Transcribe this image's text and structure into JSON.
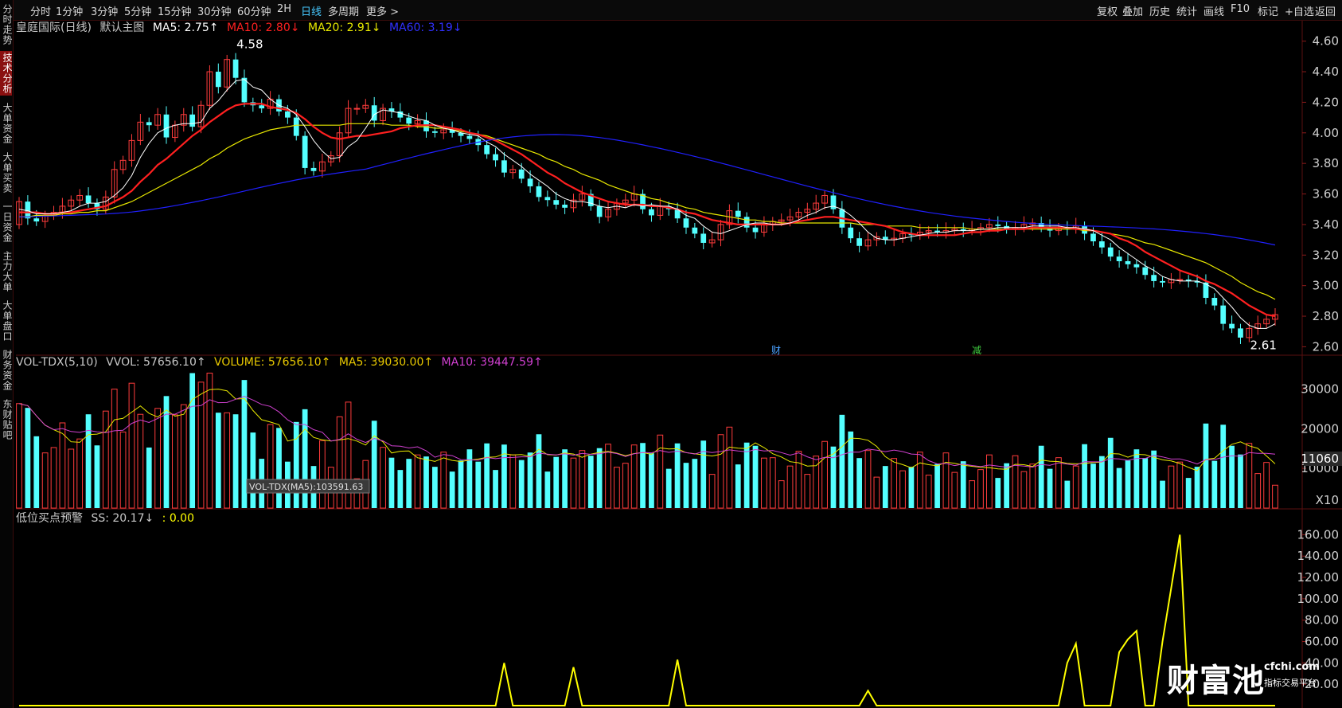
{
  "toolbar": {
    "periods": [
      "分时",
      "1分钟",
      "3分钟",
      "5分钟",
      "15分钟",
      "30分钟",
      "60分钟",
      "2H",
      "日线",
      "多周期",
      "更多 >"
    ],
    "active_period": "日线",
    "tools": [
      "复权",
      "叠加",
      "历史",
      "统计",
      "画线",
      "F10",
      "标记",
      "+自选",
      "返回"
    ]
  },
  "sidebar": {
    "tabs": [
      "分时走势",
      "技术分析",
      "大单资金",
      "大单买卖",
      "一日资金",
      "主力大单",
      "大单盘口",
      "财务资金",
      "东财贴吧"
    ],
    "active": "技术分析"
  },
  "main_panel": {
    "stock": "皇庭国际(日线)",
    "template": "默认主图",
    "ma5": "MA5: 2.75↑",
    "ma10": "MA10: 2.80↓",
    "ma20": "MA20: 2.91↓",
    "ma60": "MA60: 3.19↓",
    "high_label": "4.58",
    "low_label": "2.61",
    "markers": [
      "财",
      "减"
    ],
    "y_ticks": [
      "4.60",
      "4.40",
      "4.20",
      "4.00",
      "3.80",
      "3.60",
      "3.40",
      "3.20",
      "3.00",
      "2.80",
      "2.60"
    ],
    "y_vals": [
      4.6,
      4.4,
      4.2,
      4.0,
      3.8,
      3.6,
      3.4,
      3.2,
      3.0,
      2.8,
      2.6
    ]
  },
  "vol_panel": {
    "name": "VOL-TDX(5,10)",
    "vvol": "VVOL: 57656.10↑",
    "volume": "VOLUME: 57656.10↑",
    "ma5": "MA5: 39030.00↑",
    "ma10": "MA10: 39447.59↑",
    "tooltip": "VOL-TDX(MA5):103591.63",
    "y_ticks": [
      "30000",
      "20000",
      "10000"
    ],
    "y_vals": [
      30000,
      20000,
      10000
    ],
    "cursor_value": "11060",
    "unit": "X10"
  },
  "ind_panel": {
    "name": "低位买点预警",
    "ss": "SS: 20.17↓",
    "extra": ": 0.00",
    "y_ticks": [
      "160.00",
      "140.00",
      "120.00",
      "100.00",
      "80.00",
      "60.00",
      "40.00",
      "20.00"
    ],
    "y_vals": [
      160,
      140,
      120,
      100,
      80,
      60,
      40,
      20
    ]
  },
  "watermark": {
    "brand": "财富池",
    "site": "cfchi.com",
    "sub": "指标交易平台"
  },
  "colors": {
    "up": "#ff3c3c",
    "down": "#54ffff",
    "ma5": "#ffffff",
    "ma10": "#ff2020",
    "ma20": "#e8e800",
    "ma60": "#2020ff",
    "vol_ma5": "#e8e800",
    "vol_ma10": "#d040d0",
    "signal": "#ffff00"
  },
  "chart_data": {
    "type": "candlestick",
    "close": [
      3.55,
      3.44,
      3.42,
      3.46,
      3.48,
      3.52,
      3.56,
      3.59,
      3.54,
      3.5,
      3.58,
      3.76,
      3.82,
      3.95,
      4.07,
      4.05,
      4.12,
      3.97,
      4.05,
      4.12,
      4.04,
      4.18,
      4.4,
      4.3,
      4.48,
      4.36,
      4.2,
      4.18,
      4.16,
      4.22,
      4.14,
      4.1,
      3.98,
      3.77,
      3.75,
      3.81,
      3.85,
      4.0,
      4.16,
      4.16,
      4.18,
      4.08,
      4.16,
      4.14,
      4.1,
      4.06,
      4.08,
      4.01,
      4.0,
      4.02,
      4.0,
      3.98,
      3.96,
      3.92,
      3.86,
      3.82,
      3.74,
      3.76,
      3.7,
      3.65,
      3.58,
      3.56,
      3.53,
      3.51,
      3.56,
      3.6,
      3.52,
      3.45,
      3.5,
      3.54,
      3.56,
      3.6,
      3.5,
      3.46,
      3.52,
      3.5,
      3.44,
      3.38,
      3.34,
      3.28,
      3.3,
      3.4,
      3.49,
      3.45,
      3.38,
      3.35,
      3.4,
      3.42,
      3.43,
      3.45,
      3.48,
      3.5,
      3.54,
      3.59,
      3.5,
      3.38,
      3.31,
      3.26,
      3.3,
      3.32,
      3.3,
      3.31,
      3.34,
      3.33,
      3.35,
      3.36,
      3.35,
      3.36,
      3.37,
      3.36,
      3.37,
      3.38,
      3.4,
      3.39,
      3.37,
      3.38,
      3.4,
      3.41,
      3.38,
      3.36,
      3.38,
      3.37,
      3.39,
      3.34,
      3.29,
      3.25,
      3.19,
      3.16,
      3.14,
      3.12,
      3.07,
      3.03,
      3.02,
      3.04,
      3.04,
      3.03,
      3.02,
      2.92,
      2.87,
      2.75,
      2.72,
      2.66,
      2.72,
      2.75,
      2.78,
      2.81
    ],
    "open": [
      3.4,
      3.55,
      3.44,
      3.42,
      3.46,
      3.48,
      3.52,
      3.56,
      3.59,
      3.54,
      3.5,
      3.58,
      3.76,
      3.82,
      3.95,
      4.07,
      4.05,
      4.12,
      3.97,
      4.05,
      4.12,
      4.04,
      4.18,
      4.4,
      4.3,
      4.48,
      4.36,
      4.2,
      4.18,
      4.16,
      4.22,
      4.14,
      4.1,
      3.98,
      3.77,
      3.75,
      3.81,
      3.85,
      4.0,
      4.16,
      4.16,
      4.18,
      4.08,
      4.16,
      4.14,
      4.1,
      4.06,
      4.08,
      4.01,
      4.0,
      4.02,
      4.0,
      3.98,
      3.96,
      3.92,
      3.86,
      3.82,
      3.74,
      3.76,
      3.7,
      3.65,
      3.58,
      3.56,
      3.53,
      3.51,
      3.56,
      3.6,
      3.52,
      3.45,
      3.5,
      3.54,
      3.56,
      3.6,
      3.5,
      3.46,
      3.52,
      3.5,
      3.44,
      3.38,
      3.34,
      3.28,
      3.3,
      3.4,
      3.49,
      3.45,
      3.38,
      3.35,
      3.4,
      3.42,
      3.43,
      3.45,
      3.48,
      3.5,
      3.54,
      3.59,
      3.5,
      3.38,
      3.31,
      3.26,
      3.3,
      3.32,
      3.3,
      3.31,
      3.34,
      3.33,
      3.35,
      3.36,
      3.35,
      3.36,
      3.37,
      3.36,
      3.37,
      3.38,
      3.4,
      3.39,
      3.37,
      3.38,
      3.4,
      3.41,
      3.38,
      3.36,
      3.38,
      3.37,
      3.39,
      3.34,
      3.29,
      3.25,
      3.19,
      3.16,
      3.14,
      3.12,
      3.07,
      3.03,
      3.02,
      3.04,
      3.04,
      3.03,
      3.02,
      2.92,
      2.87,
      2.75,
      2.72,
      2.66,
      2.72,
      2.75,
      2.78
    ],
    "ma5": [
      3.5,
      3.49,
      3.47,
      3.47,
      3.47,
      3.48,
      3.49,
      3.52,
      3.54,
      3.54,
      3.55,
      3.59,
      3.64,
      3.72,
      3.84,
      3.93,
      4.0,
      4.03,
      4.05,
      4.06,
      4.06,
      4.07,
      4.16,
      4.21,
      4.28,
      4.34,
      4.35,
      4.3,
      4.28,
      4.22,
      4.18,
      4.16,
      4.12,
      4.04,
      3.95,
      3.88,
      3.83,
      3.84,
      3.91,
      3.95,
      4.03,
      4.12,
      4.15,
      4.14,
      4.13,
      4.11,
      4.09,
      4.08,
      4.05,
      4.03,
      4.02,
      4.0,
      3.99,
      3.98,
      3.94,
      3.91,
      3.86,
      3.82,
      3.78,
      3.73,
      3.69,
      3.65,
      3.6,
      3.57,
      3.55,
      3.55,
      3.54,
      3.52,
      3.51,
      3.52,
      3.51,
      3.53,
      3.52,
      3.53,
      3.52,
      3.52,
      3.5,
      3.46,
      3.44,
      3.39,
      3.35,
      3.34,
      3.36,
      3.38,
      3.4,
      3.41,
      3.41,
      3.4,
      3.4,
      3.41,
      3.43,
      3.46,
      3.48,
      3.51,
      3.52,
      3.5,
      3.46,
      3.41,
      3.35,
      3.31,
      3.3,
      3.3,
      3.31,
      3.32,
      3.33,
      3.34,
      3.35,
      3.35,
      3.36,
      3.36,
      3.36,
      3.37,
      3.37,
      3.38,
      3.38,
      3.38,
      3.38,
      3.39,
      3.39,
      3.39,
      3.39,
      3.38,
      3.38,
      3.37,
      3.36,
      3.33,
      3.3,
      3.25,
      3.21,
      3.17,
      3.13,
      3.1,
      3.06,
      3.04,
      3.03,
      3.03,
      3.03,
      3.01,
      2.98,
      2.92,
      2.86,
      2.79,
      2.74,
      2.72,
      2.72,
      2.75
    ],
    "ma10": [
      3.48,
      3.48,
      3.48,
      3.47,
      3.47,
      3.48,
      3.48,
      3.49,
      3.5,
      3.51,
      3.52,
      3.55,
      3.58,
      3.62,
      3.68,
      3.73,
      3.79,
      3.83,
      3.88,
      3.93,
      3.98,
      4.02,
      4.07,
      4.11,
      4.15,
      4.18,
      4.19,
      4.19,
      4.19,
      4.17,
      4.16,
      4.15,
      4.13,
      4.09,
      4.04,
      4.0,
      3.97,
      3.96,
      3.97,
      3.98,
      3.98,
      3.99,
      4.0,
      4.01,
      4.03,
      4.04,
      4.05,
      4.05,
      4.05,
      4.04,
      4.03,
      4.02,
      4.0,
      3.99,
      3.97,
      3.95,
      3.92,
      3.89,
      3.86,
      3.82,
      3.78,
      3.74,
      3.71,
      3.67,
      3.64,
      3.61,
      3.59,
      3.57,
      3.55,
      3.54,
      3.53,
      3.53,
      3.53,
      3.52,
      3.52,
      3.51,
      3.5,
      3.48,
      3.47,
      3.45,
      3.43,
      3.42,
      3.41,
      3.4,
      3.4,
      3.4,
      3.4,
      3.4,
      3.4,
      3.41,
      3.42,
      3.43,
      3.44,
      3.45,
      3.45,
      3.44,
      3.43,
      3.42,
      3.41,
      3.4,
      3.39,
      3.37,
      3.35,
      3.34,
      3.33,
      3.33,
      3.33,
      3.33,
      3.33,
      3.34,
      3.35,
      3.35,
      3.36,
      3.36,
      3.37,
      3.37,
      3.37,
      3.38,
      3.38,
      3.38,
      3.38,
      3.38,
      3.37,
      3.37,
      3.36,
      3.35,
      3.34,
      3.31,
      3.29,
      3.26,
      3.22,
      3.19,
      3.16,
      3.13,
      3.1,
      3.08,
      3.06,
      3.03,
      3.01,
      2.98,
      2.95,
      2.91,
      2.87,
      2.84,
      2.81,
      2.8
    ],
    "ma20": [
      3.45,
      3.45,
      3.46,
      3.46,
      3.46,
      3.47,
      3.47,
      3.48,
      3.48,
      3.49,
      3.49,
      3.51,
      3.53,
      3.55,
      3.58,
      3.61,
      3.64,
      3.67,
      3.7,
      3.73,
      3.76,
      3.79,
      3.83,
      3.86,
      3.9,
      3.93,
      3.96,
      3.98,
      4.0,
      4.02,
      4.03,
      4.04,
      4.05,
      4.05,
      4.05,
      4.05,
      4.05,
      4.05,
      4.06,
      4.06,
      4.06,
      4.06,
      4.06,
      4.05,
      4.05,
      4.05,
      4.04,
      4.04,
      4.03,
      4.03,
      4.02,
      4.01,
      4.0,
      3.99,
      3.98,
      3.96,
      3.94,
      3.92,
      3.9,
      3.88,
      3.86,
      3.83,
      3.81,
      3.78,
      3.76,
      3.73,
      3.71,
      3.69,
      3.66,
      3.64,
      3.62,
      3.6,
      3.59,
      3.57,
      3.56,
      3.54,
      3.53,
      3.51,
      3.5,
      3.48,
      3.47,
      3.46,
      3.45,
      3.44,
      3.43,
      3.43,
      3.42,
      3.42,
      3.41,
      3.41,
      3.41,
      3.41,
      3.41,
      3.41,
      3.41,
      3.41,
      3.41,
      3.4,
      3.4,
      3.4,
      3.39,
      3.39,
      3.39,
      3.39,
      3.38,
      3.38,
      3.38,
      3.38,
      3.38,
      3.38,
      3.37,
      3.37,
      3.37,
      3.37,
      3.37,
      3.37,
      3.37,
      3.37,
      3.37,
      3.37,
      3.37,
      3.37,
      3.37,
      3.36,
      3.36,
      3.35,
      3.34,
      3.33,
      3.32,
      3.3,
      3.28,
      3.27,
      3.25,
      3.23,
      3.21,
      3.19,
      3.17,
      3.15,
      3.12,
      3.09,
      3.06,
      3.02,
      2.99,
      2.96,
      2.94,
      2.91
    ]
  }
}
